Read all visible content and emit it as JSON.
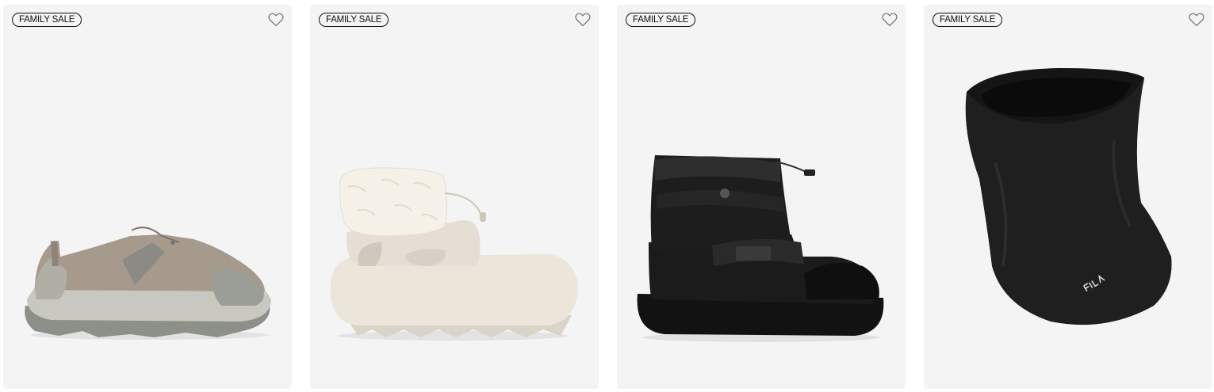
{
  "products": [
    {
      "badge": "FAMILY SALE",
      "image_alt": "Grey-beige mule sneaker with toggle lace",
      "icon": "heart-outline-icon"
    },
    {
      "badge": "FAMILY SALE",
      "image_alt": "Cream clog boot with sherpa collar",
      "icon": "heart-outline-icon"
    },
    {
      "badge": "FAMILY SALE",
      "image_alt": "Black padded winter boot with strap",
      "icon": "heart-outline-icon"
    },
    {
      "badge": "FAMILY SALE",
      "image_alt": "Black fleece neck warmer",
      "icon": "heart-outline-icon"
    }
  ],
  "colors": {
    "card_bg": "#f4f4f4",
    "badge_border": "#111111",
    "icon_stroke": "#666666"
  }
}
